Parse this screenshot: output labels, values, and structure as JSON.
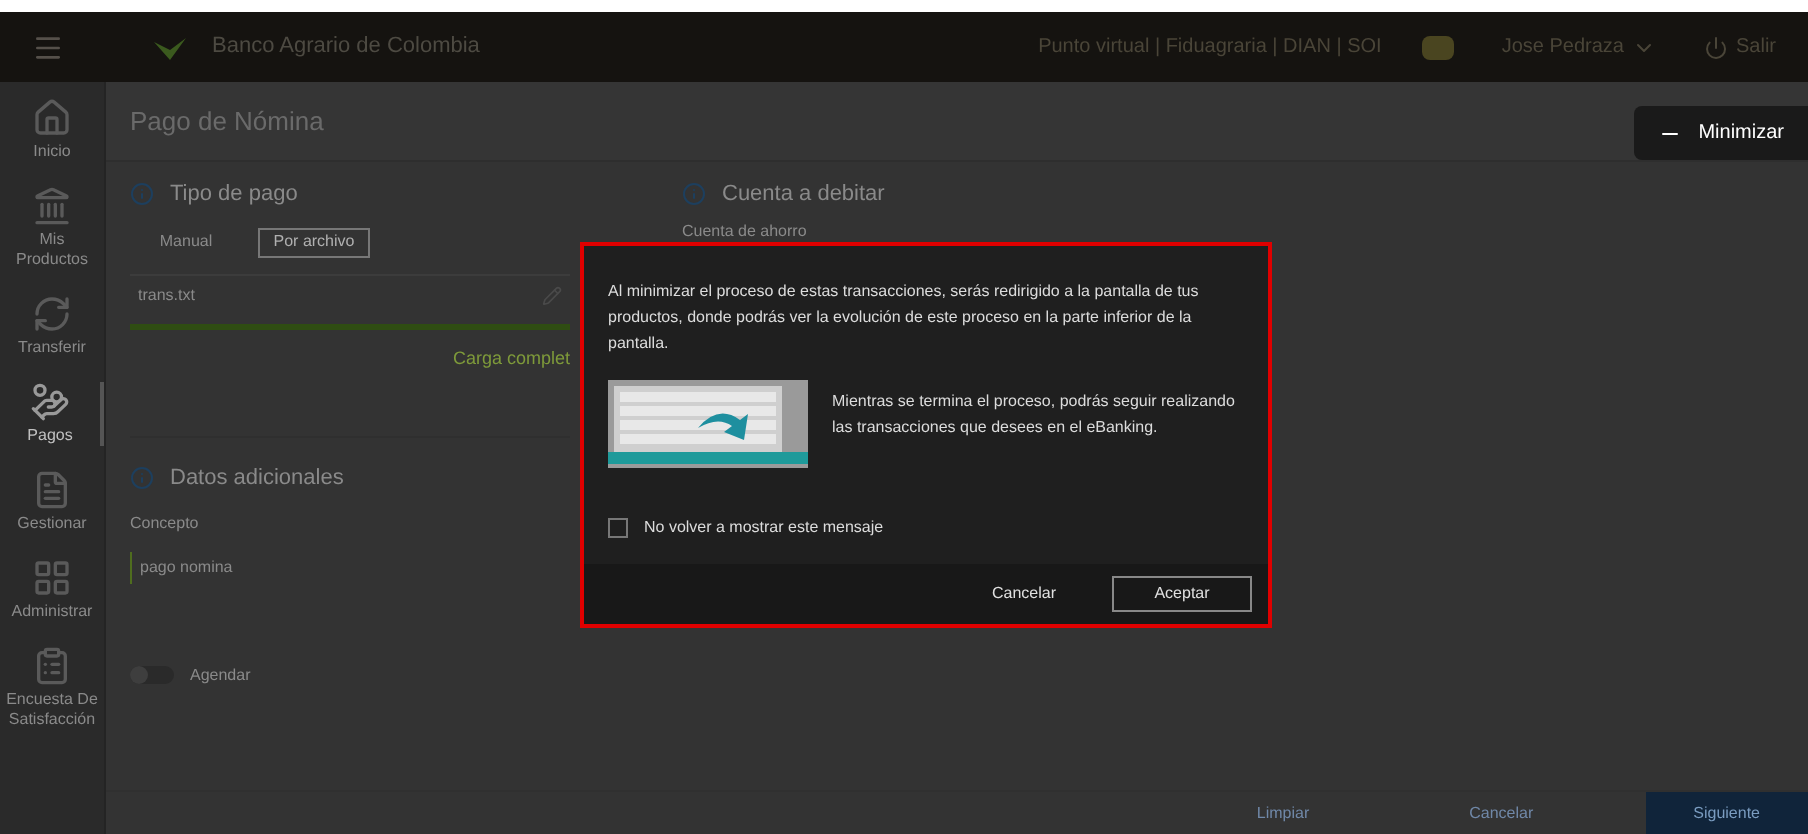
{
  "header": {
    "bank_name": "Banco Agrario de Colombia",
    "links": "Punto virtual | Fiduagraria | DIAN | SOI",
    "user": "Jose Pedraza",
    "logout": "Salir"
  },
  "sidebar": {
    "items": [
      {
        "label": "Inicio",
        "selected": false
      },
      {
        "label": "Mis Productos",
        "selected": false
      },
      {
        "label": "Transferir",
        "selected": false
      },
      {
        "label": "Pagos",
        "selected": true
      },
      {
        "label": "Gestionar",
        "selected": false
      },
      {
        "label": "Administrar",
        "selected": false
      },
      {
        "label": "Encuesta De Satisfacción",
        "selected": false
      }
    ]
  },
  "page": {
    "title": "Pago de Nómina",
    "minimize_button": "Minimizar",
    "payment_type": {
      "heading": "Tipo de pago",
      "options": [
        {
          "label": "Manual",
          "selected": false
        },
        {
          "label": "Por archivo",
          "selected": true
        }
      ],
      "file": "trans.txt",
      "level": 1,
      "status": "Carga complet"
    },
    "debit_account": {
      "heading": "Cuenta a debitar",
      "account": "Cuenta de ahorro"
    },
    "additional": {
      "heading": "Datos adicionales",
      "field_label": "Concepto",
      "field_value": "pago nomina"
    },
    "schedule": {
      "label": "Agendar",
      "on": false
    },
    "actions": [
      "Limpiar",
      "Cancelar",
      "Siguiente"
    ]
  },
  "dialog": {
    "message": "Al minimizar el proceso de estas transacciones, serás redirigido a la pantalla de tus productos, donde podrás ver la evolución de este proceso en la parte inferior de la pantalla.",
    "note": "Mientras se termina el proceso, podrás seguir realizando las transacciones que desees en el eBanking.",
    "checkbox": {
      "label": "No volver a mostrar este mensaje",
      "checked": false
    },
    "buttons": [
      {
        "label": "Cancelar",
        "kind": "text"
      },
      {
        "label": "Aceptar",
        "kind": "outline"
      }
    ]
  }
}
